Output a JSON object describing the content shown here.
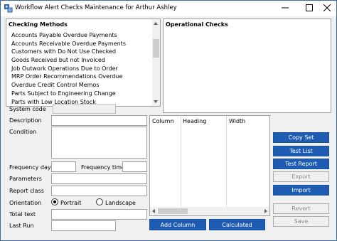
{
  "window": {
    "title": "Workflow Alert Checks Maintenance for Arthur Ashley",
    "controls": [
      "minimize-icon",
      "maximize-icon",
      "close-icon"
    ]
  },
  "checking_methods": {
    "heading": "Checking Methods",
    "items": [
      "Accounts Payable Overdue Payments",
      "Accounts Receivable Overdue Payments",
      "Customers with Do Not Use Checked",
      "Goods Received but not Invoiced",
      "Job Outwork Operations Due to Order",
      "MRP Order Recommendations Overdue",
      "Overdue Credit Control Memos",
      "Parts Subject to Engineering Change",
      "Parts with Low Location Stock"
    ]
  },
  "operational_checks": {
    "heading": "Operational Checks"
  },
  "form": {
    "system_code_label": "System code",
    "description_label": "Description",
    "condition_label": "Condition",
    "frequency_days_label": "Frequency days",
    "frequency_time_label": "Frequency time",
    "parameters_label": "Parameters",
    "report_class_label": "Report class",
    "orientation_label": "Orientation",
    "orientation_portrait": "Portrait",
    "orientation_landscape": "Landscape",
    "orientation_selected": "Portrait",
    "total_text_label": "Total text",
    "last_run_label": "Last Run"
  },
  "columns_grid": {
    "headers": [
      "Column",
      "Heading",
      "Width"
    ]
  },
  "buttons": {
    "add_column": "Add Column",
    "calculated": "Calculated",
    "copy_set": "Copy Set",
    "test_list": "Test List",
    "test_report": "Test Report",
    "export": "Export",
    "import": "Import",
    "revert": "Revert",
    "save": "Save"
  },
  "colors": {
    "accent_button": "#1e5cb3",
    "window_border": "#3a6ea5",
    "background": "#f0f0f0"
  }
}
